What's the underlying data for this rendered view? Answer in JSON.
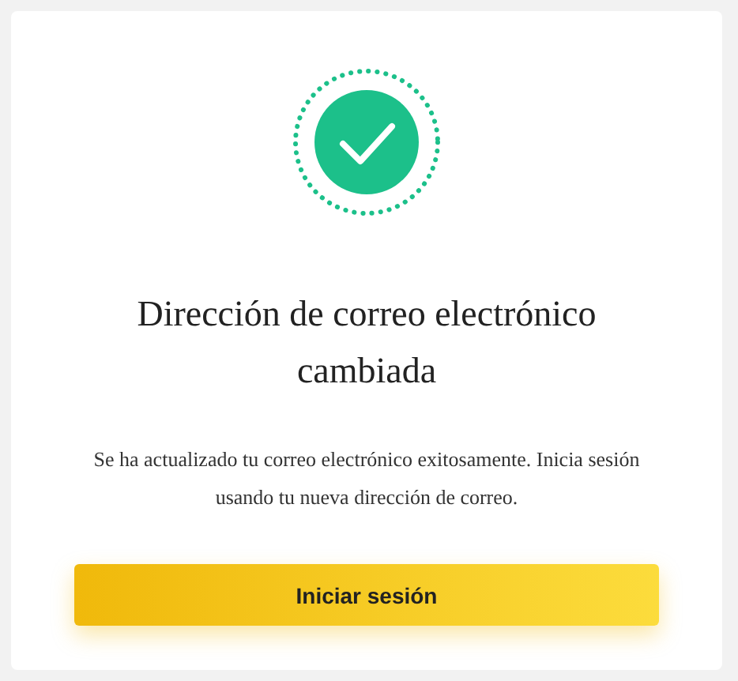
{
  "title": "Dirección de correo electrónico cambiada",
  "message": "Se ha actualizado tu correo electrónico exitosamente. Inicia sesión usando tu nueva dirección de correo.",
  "button": "Iniciar sesión"
}
